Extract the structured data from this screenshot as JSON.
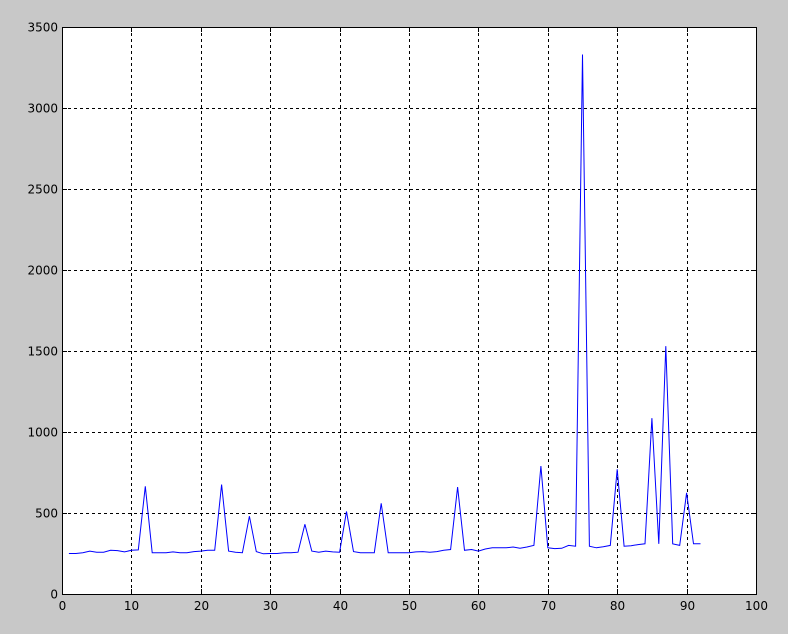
{
  "colors": {
    "figure_background": "#c8c8c8",
    "axes_background": "#ffffff",
    "axes_border": "#000000",
    "grid": "#000000",
    "line": "#0000ff"
  },
  "chart_data": {
    "type": "line",
    "title": "",
    "xlabel": "",
    "ylabel": "",
    "xlim": [
      0,
      100
    ],
    "ylim": [
      0,
      3500
    ],
    "xticks": [
      0,
      10,
      20,
      30,
      40,
      50,
      60,
      70,
      80,
      90,
      100
    ],
    "yticks": [
      0,
      500,
      1000,
      1500,
      2000,
      2500,
      3000,
      3500
    ],
    "grid": true,
    "grid_style": "dashed",
    "legend": "none",
    "series": [
      {
        "x": [
          1,
          2,
          3,
          4,
          5,
          6,
          7,
          8,
          9,
          10,
          11,
          12,
          13,
          14,
          15,
          16,
          17,
          18,
          19,
          20,
          21,
          22,
          23,
          24,
          25,
          26,
          27,
          28,
          29,
          30,
          31,
          32,
          33,
          34,
          35,
          36,
          37,
          38,
          39,
          40,
          41,
          42,
          43,
          44,
          45,
          46,
          47,
          48,
          49,
          50,
          51,
          52,
          53,
          54,
          55,
          56,
          57,
          58,
          59,
          60,
          61,
          62,
          63,
          64,
          65,
          66,
          67,
          68,
          69,
          70,
          71,
          72,
          73,
          74,
          75,
          76,
          77,
          78,
          79,
          80,
          81,
          82,
          83,
          84,
          85,
          86,
          87,
          88,
          89,
          90,
          91,
          92
        ],
        "y": [
          250,
          250,
          255,
          265,
          258,
          258,
          270,
          268,
          260,
          270,
          272,
          665,
          255,
          255,
          255,
          260,
          255,
          255,
          262,
          265,
          270,
          270,
          675,
          265,
          258,
          255,
          480,
          262,
          248,
          250,
          250,
          255,
          255,
          258,
          430,
          265,
          258,
          265,
          260,
          258,
          510,
          262,
          255,
          255,
          255,
          560,
          255,
          255,
          255,
          255,
          260,
          262,
          258,
          262,
          270,
          275,
          660,
          270,
          275,
          265,
          278,
          285,
          285,
          285,
          290,
          283,
          290,
          300,
          790,
          285,
          280,
          282,
          300,
          295,
          3330,
          295,
          285,
          292,
          300,
          770,
          295,
          298,
          305,
          310,
          1085,
          310,
          1530,
          310,
          300,
          625,
          310,
          310
        ]
      }
    ]
  }
}
